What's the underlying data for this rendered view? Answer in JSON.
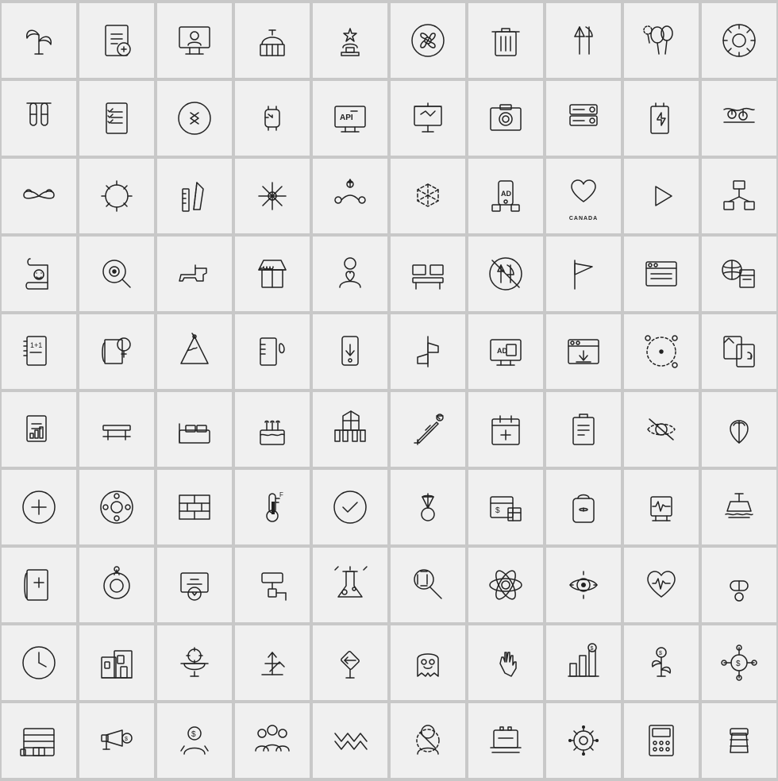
{
  "grid": {
    "cols": 10,
    "rows": 10,
    "icons": [
      {
        "id": "row1-1",
        "name": "plants",
        "label": ""
      },
      {
        "id": "row1-2",
        "name": "document-add",
        "label": ""
      },
      {
        "id": "row1-3",
        "name": "monitor-user",
        "label": ""
      },
      {
        "id": "row1-4",
        "name": "building-dome",
        "label": ""
      },
      {
        "id": "row1-5",
        "name": "trophy-star",
        "label": ""
      },
      {
        "id": "row1-6",
        "name": "fan-circle",
        "label": ""
      },
      {
        "id": "row1-7",
        "name": "trash-can",
        "label": ""
      },
      {
        "id": "row1-8",
        "name": "utensils",
        "label": ""
      },
      {
        "id": "row1-9",
        "name": "balloons",
        "label": ""
      },
      {
        "id": "row1-10",
        "name": "gear-circle",
        "label": ""
      },
      {
        "id": "row2-1",
        "name": "test-tubes",
        "label": ""
      },
      {
        "id": "row2-2",
        "name": "checklist",
        "label": ""
      },
      {
        "id": "row2-3",
        "name": "play-circle-bluetooth",
        "label": ""
      },
      {
        "id": "row2-4",
        "name": "smartwatch",
        "label": ""
      },
      {
        "id": "row2-5",
        "name": "api-monitor",
        "label": ""
      },
      {
        "id": "row2-6",
        "name": "presentation",
        "label": ""
      },
      {
        "id": "row2-7",
        "name": "camera-box",
        "label": ""
      },
      {
        "id": "row2-8",
        "name": "server-tray",
        "label": ""
      },
      {
        "id": "row2-9",
        "name": "battery-bolt",
        "label": ""
      },
      {
        "id": "row2-10",
        "name": "festival-lights",
        "label": ""
      },
      {
        "id": "row3-1",
        "name": "wings",
        "label": ""
      },
      {
        "id": "row3-2",
        "name": "sun-circle",
        "label": ""
      },
      {
        "id": "row3-3",
        "name": "ruler-pencil",
        "label": ""
      },
      {
        "id": "row3-4",
        "name": "snowflake-flower",
        "label": ""
      },
      {
        "id": "row3-5",
        "name": "ai-path",
        "label": ""
      },
      {
        "id": "row3-6",
        "name": "ar-cube",
        "label": ""
      },
      {
        "id": "row3-7",
        "name": "ad-phone",
        "label": ""
      },
      {
        "id": "row3-8",
        "name": "canada-heart",
        "label": "CANADA"
      },
      {
        "id": "row3-9",
        "name": "play-button",
        "label": ""
      },
      {
        "id": "row3-10",
        "name": "network-diagram",
        "label": ""
      },
      {
        "id": "row4-1",
        "name": "scroll-face",
        "label": ""
      },
      {
        "id": "row4-2",
        "name": "magnify-egg",
        "label": ""
      },
      {
        "id": "row4-3",
        "name": "pistol",
        "label": ""
      },
      {
        "id": "row4-4",
        "name": "market-stall",
        "label": ""
      },
      {
        "id": "row4-5",
        "name": "person-heart",
        "label": ""
      },
      {
        "id": "row4-6",
        "name": "gallery-furniture",
        "label": ""
      },
      {
        "id": "row4-7",
        "name": "no-cutlery",
        "label": ""
      },
      {
        "id": "row4-8",
        "name": "flag",
        "label": ""
      },
      {
        "id": "row4-9",
        "name": "browser-list",
        "label": ""
      },
      {
        "id": "row4-10",
        "name": "globe-document",
        "label": ""
      },
      {
        "id": "row5-1",
        "name": "notepad-math",
        "label": ""
      },
      {
        "id": "row5-2",
        "name": "book-head",
        "label": ""
      },
      {
        "id": "row5-3",
        "name": "party-hat",
        "label": ""
      },
      {
        "id": "row5-4",
        "name": "ruler-droplet",
        "label": ""
      },
      {
        "id": "row5-5",
        "name": "phone-download",
        "label": ""
      },
      {
        "id": "row5-6",
        "name": "signpost",
        "label": ""
      },
      {
        "id": "row5-7",
        "name": "monitor-ad",
        "label": ""
      },
      {
        "id": "row5-8",
        "name": "browser-download",
        "label": ""
      },
      {
        "id": "row5-9",
        "name": "target-stars",
        "label": ""
      },
      {
        "id": "row5-10",
        "name": "file-sync",
        "label": ""
      },
      {
        "id": "row6-1",
        "name": "report-chart",
        "label": ""
      },
      {
        "id": "row6-2",
        "name": "table-furniture",
        "label": ""
      },
      {
        "id": "row6-3",
        "name": "bed",
        "label": ""
      },
      {
        "id": "row6-4",
        "name": "birthday-cake",
        "label": ""
      },
      {
        "id": "row6-5",
        "name": "fence-house",
        "label": ""
      },
      {
        "id": "row6-6",
        "name": "syringe",
        "label": ""
      },
      {
        "id": "row6-7",
        "name": "medical-calendar",
        "label": ""
      },
      {
        "id": "row6-8",
        "name": "clipboard",
        "label": ""
      },
      {
        "id": "row6-9",
        "name": "eye-hidden",
        "label": ""
      },
      {
        "id": "row6-10",
        "name": "plant-gift",
        "label": ""
      },
      {
        "id": "row7-1",
        "name": "medical-plus-circle",
        "label": ""
      },
      {
        "id": "row7-2",
        "name": "film-reel",
        "label": ""
      },
      {
        "id": "row7-3",
        "name": "brick-wall",
        "label": ""
      },
      {
        "id": "row7-4",
        "name": "thermometer",
        "label": ""
      },
      {
        "id": "row7-5",
        "name": "checkmark-circle",
        "label": ""
      },
      {
        "id": "row7-6",
        "name": "shuttlecock",
        "label": ""
      },
      {
        "id": "row7-7",
        "name": "dollar-plan",
        "label": ""
      },
      {
        "id": "row7-8",
        "name": "backpack",
        "label": ""
      },
      {
        "id": "row7-9",
        "name": "heart-monitor",
        "label": ""
      },
      {
        "id": "row7-10",
        "name": "ship",
        "label": ""
      },
      {
        "id": "row8-1",
        "name": "bible",
        "label": ""
      },
      {
        "id": "row8-2",
        "name": "weight-ring",
        "label": ""
      },
      {
        "id": "row8-3",
        "name": "certificate-trophy",
        "label": ""
      },
      {
        "id": "row8-4",
        "name": "paint-roller",
        "label": ""
      },
      {
        "id": "row8-5",
        "name": "lab-flask-stars",
        "label": ""
      },
      {
        "id": "row8-6",
        "name": "badminton",
        "label": ""
      },
      {
        "id": "row8-7",
        "name": "atom-flower",
        "label": ""
      },
      {
        "id": "row8-8",
        "name": "eye-target",
        "label": ""
      },
      {
        "id": "row8-9",
        "name": "heartbeat",
        "label": ""
      },
      {
        "id": "row8-10",
        "name": "pill",
        "label": ""
      },
      {
        "id": "row9-1",
        "name": "clock",
        "label": ""
      },
      {
        "id": "row9-2",
        "name": "city-report",
        "label": ""
      },
      {
        "id": "row9-3",
        "name": "bowl-gear",
        "label": ""
      },
      {
        "id": "row9-4",
        "name": "growth-arrows",
        "label": ""
      },
      {
        "id": "row9-5",
        "name": "road-sign",
        "label": ""
      },
      {
        "id": "row9-6",
        "name": "ghost",
        "label": ""
      },
      {
        "id": "row9-7",
        "name": "hand-click",
        "label": ""
      },
      {
        "id": "row9-8",
        "name": "bar-chart-dollar",
        "label": ""
      },
      {
        "id": "row9-9",
        "name": "plant-money",
        "label": ""
      },
      {
        "id": "row9-10",
        "name": "circuit-dollar",
        "label": ""
      },
      {
        "id": "row10-1",
        "name": "garage-door",
        "label": ""
      },
      {
        "id": "row10-2",
        "name": "megaphone-dollar",
        "label": ""
      },
      {
        "id": "row10-3",
        "name": "hands-dollar",
        "label": ""
      },
      {
        "id": "row10-4",
        "name": "people-group",
        "label": ""
      },
      {
        "id": "row10-5",
        "name": "zigzag-pattern",
        "label": ""
      },
      {
        "id": "row10-6",
        "name": "person-block",
        "label": ""
      },
      {
        "id": "row10-7",
        "name": "laptop-scan",
        "label": ""
      },
      {
        "id": "row10-8",
        "name": "virus",
        "label": ""
      },
      {
        "id": "row10-9",
        "name": "calculator-grid",
        "label": ""
      },
      {
        "id": "row10-10",
        "name": "jar-store",
        "label": ""
      }
    ]
  }
}
